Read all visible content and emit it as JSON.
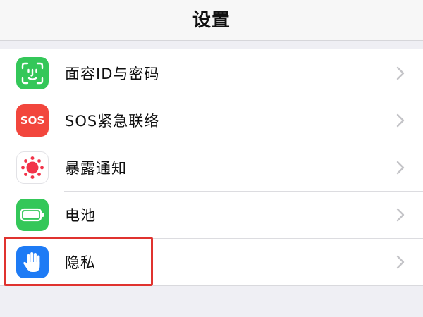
{
  "navbar": {
    "title": "设置"
  },
  "settings": {
    "items": [
      {
        "label": "面容ID与密码",
        "icon": "face-id-icon",
        "color": "#34c759"
      },
      {
        "label": "SOS紧急联络",
        "icon": "sos-icon",
        "icon_text": "SOS",
        "color": "#f2463d"
      },
      {
        "label": "暴露通知",
        "icon": "exposure-notification-icon",
        "color": "#ffffff"
      },
      {
        "label": "电池",
        "icon": "battery-icon",
        "color": "#34c759"
      },
      {
        "label": "隐私",
        "icon": "privacy-hand-icon",
        "color": "#1e7bf5"
      }
    ]
  },
  "annotation": {
    "highlight_color": "#e0332f"
  }
}
